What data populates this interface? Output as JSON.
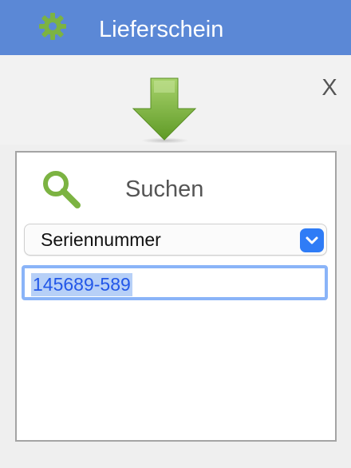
{
  "window": {
    "title": "Lieferschein",
    "close_label": "X",
    "icons": {
      "title": "gear-icon",
      "arrow": "download-arrow-icon",
      "search": "search-icon",
      "chevron": "chevron-down-icon"
    }
  },
  "search": {
    "label": "Suchen",
    "field_type": "Seriennummer",
    "value": "145689-589"
  },
  "colors": {
    "titlebar": "#5b88d6",
    "accent_green": "#7cb342",
    "select_blue": "#2f7cf6"
  }
}
